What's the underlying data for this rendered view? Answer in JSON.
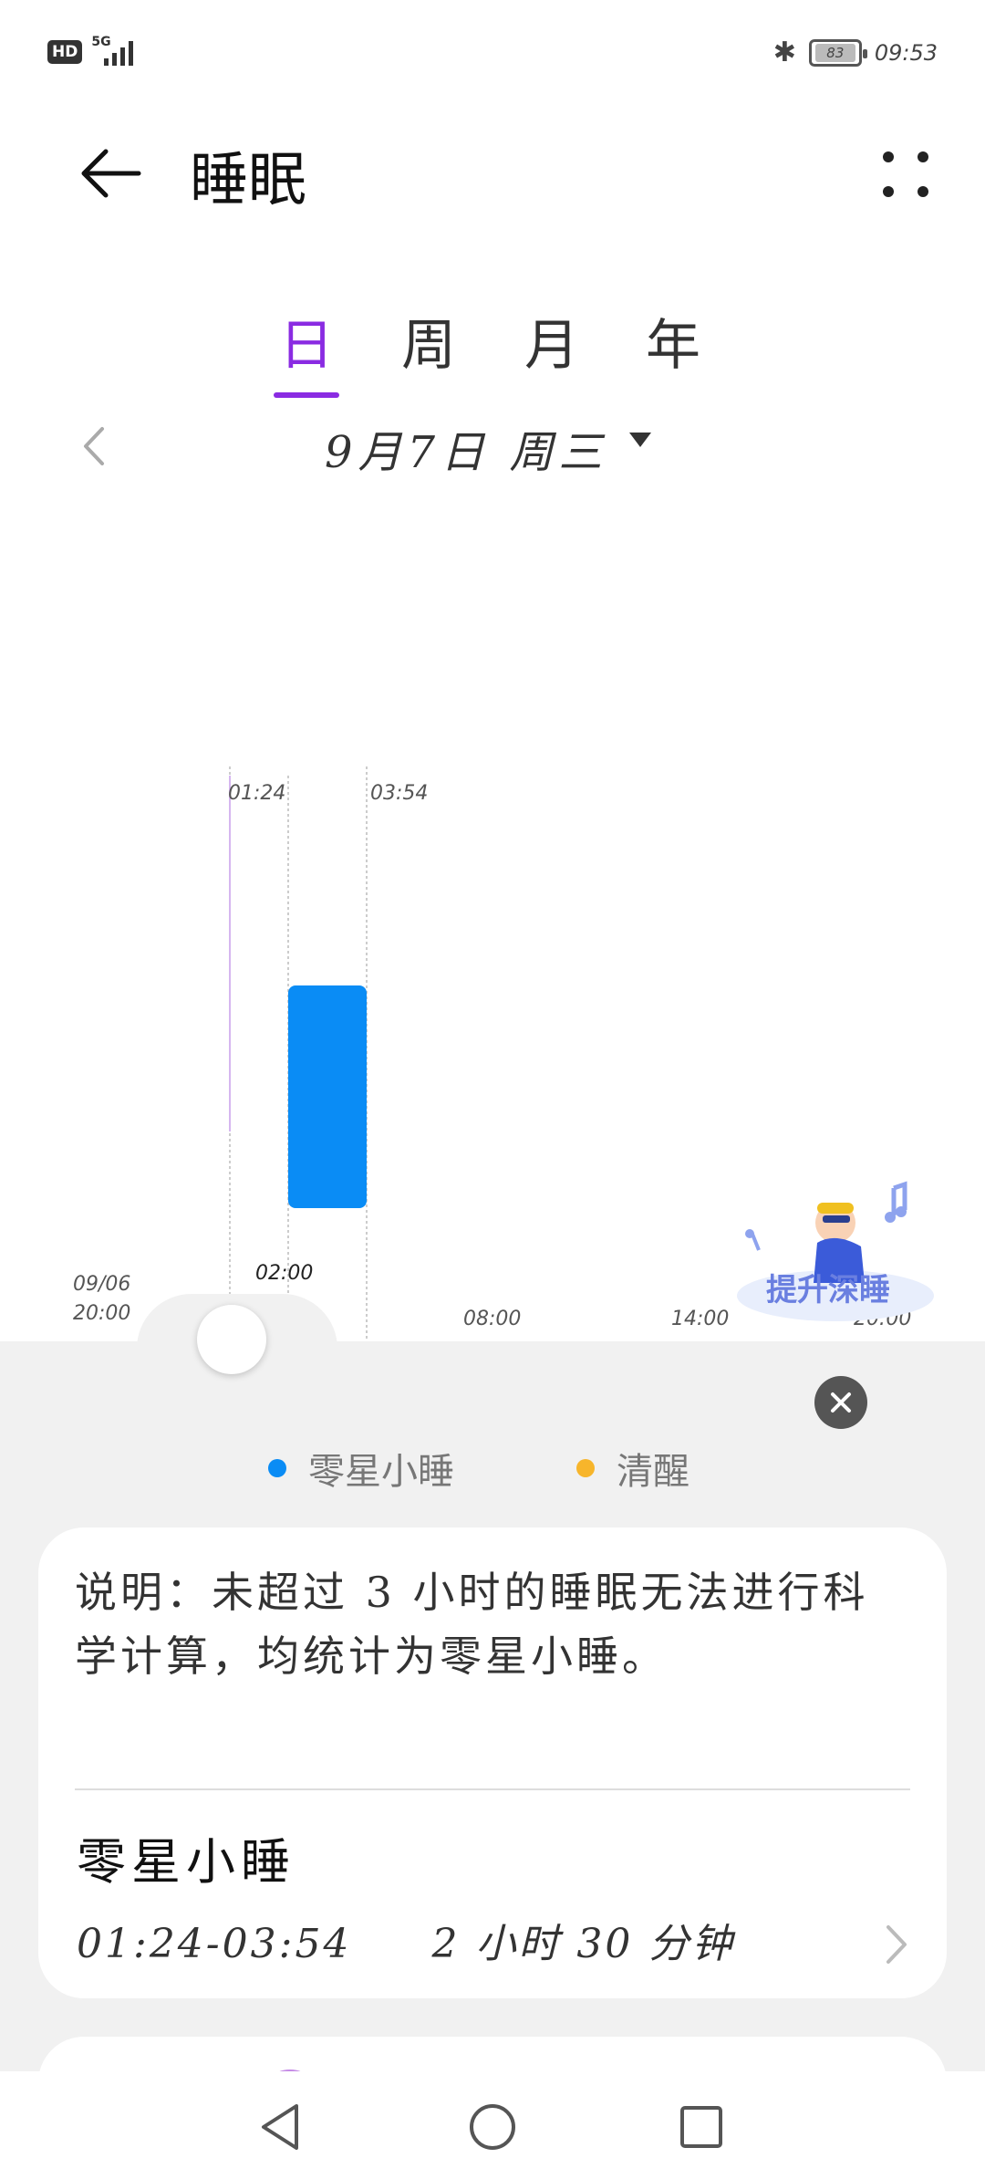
{
  "status_bar": {
    "hd": "HD",
    "network": "5G",
    "battery": "83",
    "time": "09:53"
  },
  "header": {
    "title": "睡眠",
    "back_icon": "arrow-left-icon",
    "more_icon": "four-dots-icon"
  },
  "tabs": [
    {
      "label": "日",
      "active": true
    },
    {
      "label": "周",
      "active": false
    },
    {
      "label": "月",
      "active": false
    },
    {
      "label": "年",
      "active": false
    }
  ],
  "date_nav": {
    "label": "9月7日 周三"
  },
  "chart_data": {
    "type": "bar",
    "x_labels": [
      {
        "line1": "09/06",
        "line2": "20:00"
      },
      {
        "line1": "02:00"
      },
      {
        "line1": "08:00"
      },
      {
        "line1": "14:00"
      },
      {
        "line1": "20:00"
      }
    ],
    "markers": [
      "01:24",
      "03:54"
    ],
    "segments": [
      {
        "name": "零星小睡",
        "start": "01:24",
        "end": "03:54",
        "highlight_start": "02:00",
        "color": "#0a8cf5"
      }
    ]
  },
  "promo": {
    "label": "提升深睡"
  },
  "legend": [
    {
      "label": "零星小睡",
      "color": "#0a8cf5"
    },
    {
      "label": "清醒",
      "color": "#f7b52b"
    }
  ],
  "card": {
    "note": "说明：未超过 3 小时的睡眠无法进行科学计算，均统计为零星小睡。",
    "record_title": "零星小睡",
    "record_time": "01:24-03:54",
    "record_duration": "2 小时 30 分钟"
  },
  "nav": {
    "back": "back-triangle-icon",
    "home": "home-circle-icon",
    "recents": "recents-square-icon"
  }
}
